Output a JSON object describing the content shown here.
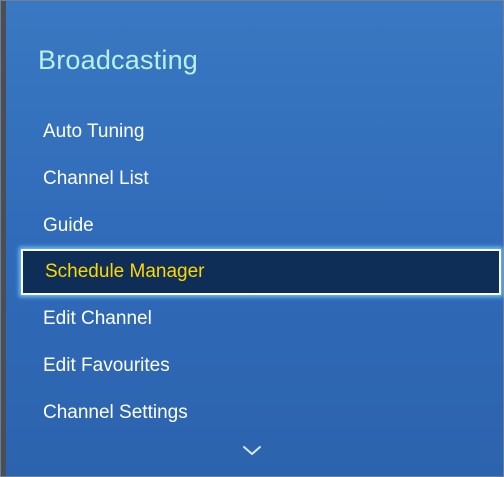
{
  "menu": {
    "title": "Broadcasting",
    "items": [
      {
        "label": "Auto Tuning"
      },
      {
        "label": "Channel List"
      },
      {
        "label": "Guide"
      },
      {
        "label": "Schedule Manager",
        "selected": true
      },
      {
        "label": "Edit Channel"
      },
      {
        "label": "Edit Favourites"
      },
      {
        "label": "Channel Settings"
      }
    ],
    "more_indicator_icon": "chevron-down-icon"
  },
  "colors": {
    "panel_background": "#3a78c2",
    "title_text": "#b8f0e6",
    "selected_background": "#0e2e57",
    "selected_text": "#ffd700",
    "selected_border": "#ffffff"
  }
}
